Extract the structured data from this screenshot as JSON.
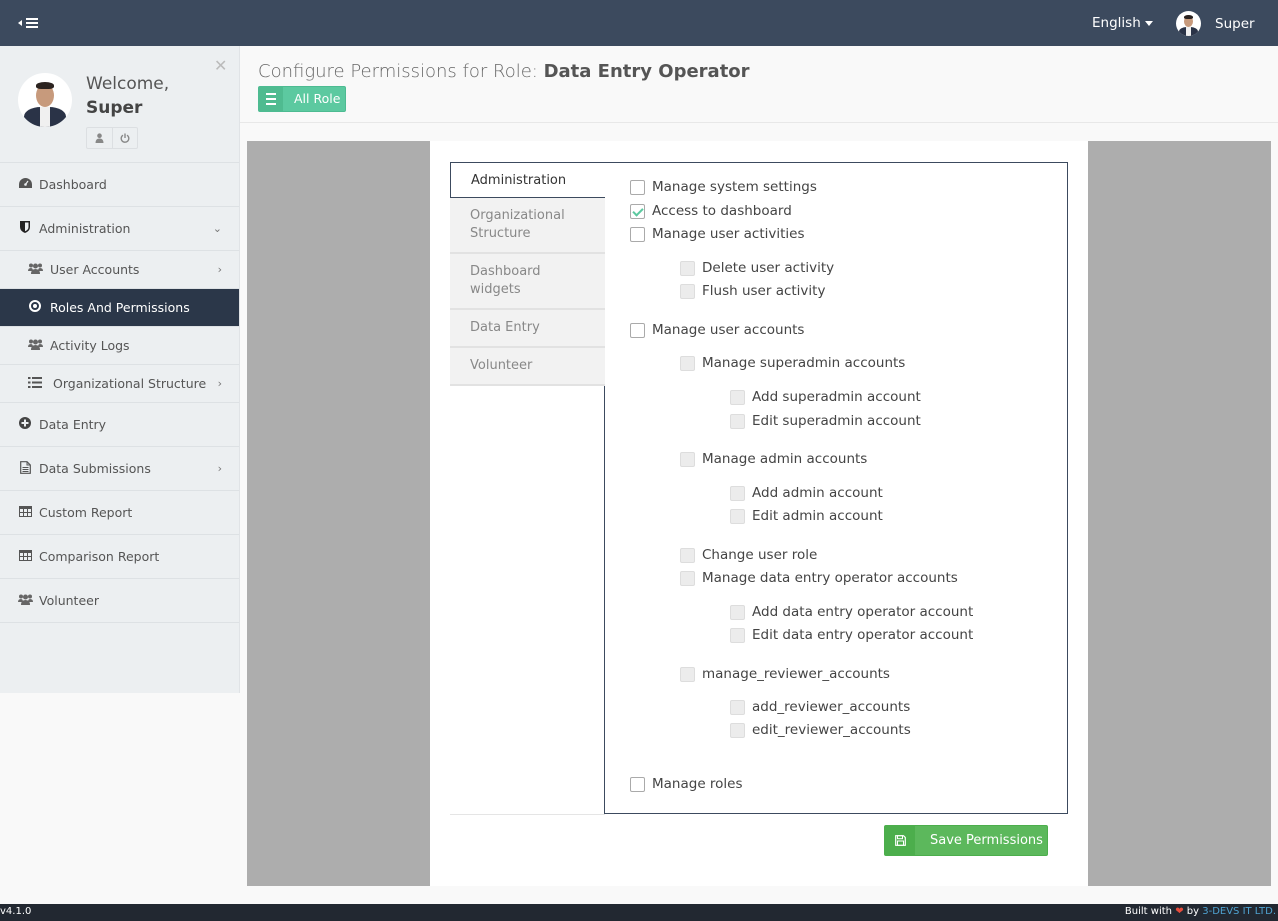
{
  "topbar": {
    "language": "English",
    "user_name": "Super"
  },
  "sidebar": {
    "welcome": "Welcome,",
    "user_name": "Super",
    "items": [
      {
        "label": "Dashboard",
        "icon": "dashboard-icon"
      },
      {
        "label": "Administration",
        "icon": "shield-icon",
        "expanded": true
      },
      {
        "label": "User Accounts",
        "icon": "users-icon",
        "sub": true
      },
      {
        "label": "Roles And Permissions",
        "icon": "dot-circle-icon",
        "sub": true,
        "active": true
      },
      {
        "label": "Activity Logs",
        "icon": "users-icon",
        "sub": true
      },
      {
        "label": "Organizational Structure",
        "icon": "list-icon",
        "sub": true
      },
      {
        "label": "Data Entry",
        "icon": "plus-circle-icon"
      },
      {
        "label": "Data Submissions",
        "icon": "file-icon"
      },
      {
        "label": "Custom Report",
        "icon": "table-icon"
      },
      {
        "label": "Comparison Report",
        "icon": "table-icon"
      },
      {
        "label": "Volunteer",
        "icon": "users-icon"
      }
    ]
  },
  "header": {
    "title_prefix": "Configure Permissions for Role:",
    "role_name": "Data Entry Operator",
    "all_role_label": "All Role"
  },
  "tabs": [
    {
      "label": "Administration",
      "active": true
    },
    {
      "label": "Organizational Structure"
    },
    {
      "label": "Dashboard widgets"
    },
    {
      "label": "Data Entry"
    },
    {
      "label": "Volunteer"
    }
  ],
  "permissions": [
    {
      "label": "Manage system settings",
      "checked": false,
      "disabled": false
    },
    {
      "label": "Access to dashboard",
      "checked": true,
      "disabled": false
    },
    {
      "label": "Manage user activities",
      "checked": false,
      "disabled": false
    },
    {
      "label": "Delete user activity",
      "checked": false,
      "disabled": true
    },
    {
      "label": "Flush user activity",
      "checked": false,
      "disabled": true
    },
    {
      "label": "Manage user accounts",
      "checked": false,
      "disabled": false
    },
    {
      "label": "Manage superadmin accounts",
      "checked": false,
      "disabled": true
    },
    {
      "label": "Add superadmin account",
      "checked": false,
      "disabled": true
    },
    {
      "label": "Edit superadmin account",
      "checked": false,
      "disabled": true
    },
    {
      "label": "Manage admin accounts",
      "checked": false,
      "disabled": true
    },
    {
      "label": "Add admin account",
      "checked": false,
      "disabled": true
    },
    {
      "label": "Edit admin account",
      "checked": false,
      "disabled": true
    },
    {
      "label": "Change user role",
      "checked": false,
      "disabled": true
    },
    {
      "label": "Manage data entry operator accounts",
      "checked": false,
      "disabled": true
    },
    {
      "label": "Add data entry operator account",
      "checked": false,
      "disabled": true
    },
    {
      "label": "Edit data entry operator account",
      "checked": false,
      "disabled": true
    },
    {
      "label": "manage_reviewer_accounts",
      "checked": false,
      "disabled": true
    },
    {
      "label": "add_reviewer_accounts",
      "checked": false,
      "disabled": true
    },
    {
      "label": "edit_reviewer_accounts",
      "checked": false,
      "disabled": true
    },
    {
      "label": "Manage roles",
      "checked": false,
      "disabled": false
    }
  ],
  "save_label": "Save Permissions",
  "footer": {
    "version": "v4.1.0",
    "built_with": "Built with",
    "by": "by",
    "company": "3-DEVS IT LTD."
  },
  "colors": {
    "topbar": "#3c4a5e",
    "active_nav": "#2b3749",
    "accent_green": "#5cc9a0",
    "save_green": "#5cb85c"
  }
}
